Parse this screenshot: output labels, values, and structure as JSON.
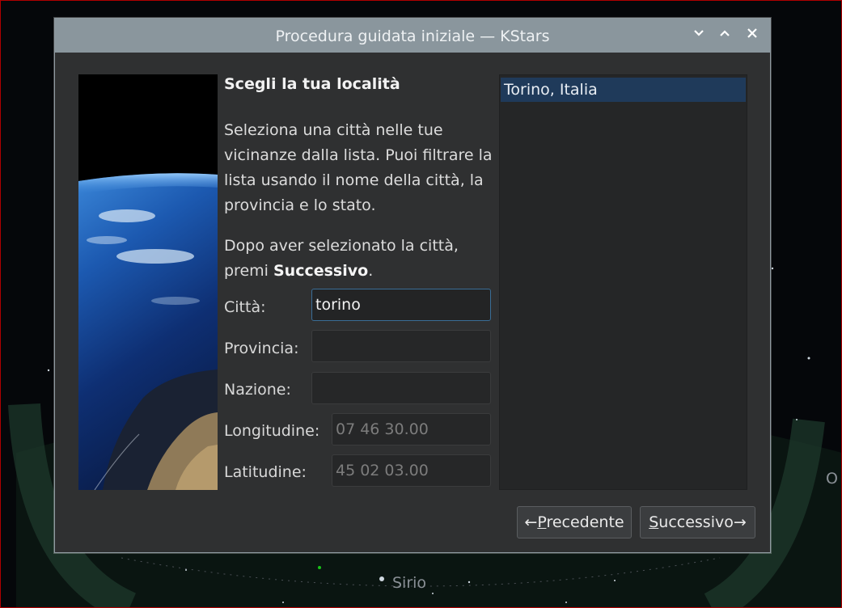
{
  "sky": {
    "star_label": "Sirio",
    "edge_label": "O"
  },
  "window": {
    "title": "Procedura guidata iniziale — KStars",
    "buttons": {
      "minimize": "⌄",
      "maximize": "⌃",
      "close": "✕"
    }
  },
  "page": {
    "heading": "Scegli la tua località",
    "description": "Seleziona una città nelle tue vicinanze dalla lista. Puoi filtrare la lista usando il nome della città, la provincia e lo stato.",
    "instruction_prefix": "Dopo aver selezionato la città, premi ",
    "instruction_bold": "Successivo",
    "instruction_suffix": "."
  },
  "form": {
    "city_label": "Città:",
    "city_value": "torino",
    "province_label": "Provincia:",
    "province_value": "",
    "country_label": "Nazione:",
    "country_value": "",
    "longitude_label": "Longitudine:",
    "longitude_value": "07 46 30.00",
    "latitude_label": "Latitudine:",
    "latitude_value": "45 02 03.00"
  },
  "city_list": [
    "Torino, Italia"
  ],
  "nav": {
    "back_arrow": "←",
    "back_mnemonic": "P",
    "back_rest": "recedente",
    "next_mnemonic": "S",
    "next_rest": "uccessivo",
    "next_arrow": "→"
  },
  "colors": {
    "titlebar": "#8a969d",
    "dialog_bg": "#2f3031",
    "selection": "#1f3a5a",
    "focus_border": "#3a6d96"
  }
}
